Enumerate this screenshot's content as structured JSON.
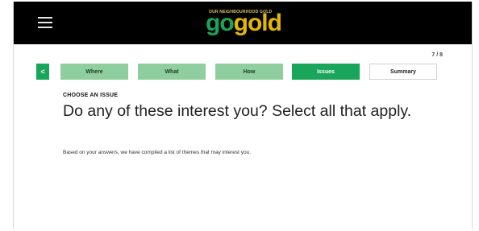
{
  "header": {
    "menu_icon": "hamburger-menu-icon",
    "logo": {
      "tagline": "OUR NEIGHBOURHOOD GOLD",
      "word_go": "go",
      "word_gold": "gold",
      "color_go": "#19a55a",
      "color_gold": "#e3b800"
    }
  },
  "progress": {
    "text": "7 / 8"
  },
  "steps": {
    "back_icon": "chevron-left-icon",
    "back_glyph": "<",
    "items": [
      {
        "label": "Where",
        "state": "done"
      },
      {
        "label": "What",
        "state": "done"
      },
      {
        "label": "How",
        "state": "done"
      },
      {
        "label": "Issues",
        "state": "active"
      },
      {
        "label": "Summary",
        "state": "todo"
      }
    ]
  },
  "content": {
    "eyebrow": "CHOOSE AN ISSUE",
    "question": "Do any of these interest you? Select all that apply.",
    "description": "Based on your answers, we have compiled a list of themes that may interest you."
  },
  "colors": {
    "topbar": "#000000",
    "accent": "#19a55a",
    "step_done": "#8fcf9f"
  }
}
